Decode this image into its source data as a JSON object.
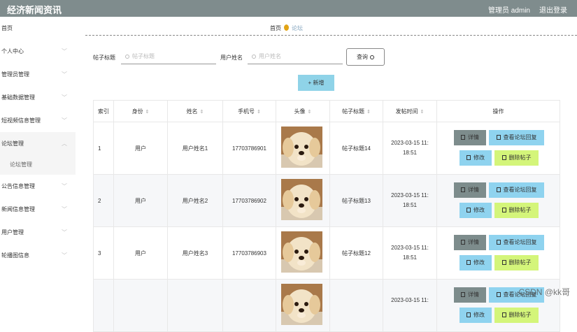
{
  "app": {
    "title": "经济新闻资讯",
    "admin_label": "管理员 admin",
    "logout_label": "退出登录"
  },
  "sidebar": {
    "items": [
      {
        "label": "首页",
        "has_chevron": false
      },
      {
        "label": "个人中心",
        "has_chevron": true
      },
      {
        "label": "管理员管理",
        "has_chevron": true
      },
      {
        "label": "基础数据管理",
        "has_chevron": true
      },
      {
        "label": "短视频信息管理",
        "has_chevron": true
      },
      {
        "label": "论坛管理",
        "has_chevron": true,
        "open": true
      },
      {
        "label": "公告信息管理",
        "has_chevron": true
      },
      {
        "label": "新闻信息管理",
        "has_chevron": true
      },
      {
        "label": "用户管理",
        "has_chevron": true
      },
      {
        "label": "轮播图信息",
        "has_chevron": true
      }
    ],
    "sub_item": "论坛管理"
  },
  "breadcrumb": {
    "home": "首页",
    "current": "论坛"
  },
  "search": {
    "title_label": "帖子标题",
    "title_placeholder": "帖子标题",
    "user_label": "用户姓名",
    "user_placeholder": "用户姓名",
    "search_button": "查询",
    "add_button": "+ 新增"
  },
  "table": {
    "headers": [
      "索引",
      "身份",
      "姓名",
      "手机号",
      "头像",
      "帖子标题",
      "发帖时间",
      "操作"
    ],
    "rows": [
      {
        "index": "1",
        "role": "用户",
        "name": "用户姓名1",
        "phone": "17703786901",
        "post_title": "帖子标题14",
        "time_line1": "2023-03-15 11:",
        "time_line2": "18:51"
      },
      {
        "index": "2",
        "role": "用户",
        "name": "用户姓名2",
        "phone": "17703786902",
        "post_title": "帖子标题13",
        "time_line1": "2023-03-15 11:",
        "time_line2": "18:51"
      },
      {
        "index": "3",
        "role": "用户",
        "name": "用户姓名3",
        "phone": "17703786903",
        "post_title": "帖子标题12",
        "time_line1": "2023-03-15 11:",
        "time_line2": "18:51"
      },
      {
        "index": "",
        "role": "",
        "name": "",
        "phone": "",
        "post_title": "",
        "time_line1": "2023-03-15 11:",
        "time_line2": ""
      }
    ],
    "actions": {
      "detail": "详情",
      "view_replies": "查看论坛回复",
      "edit": "修改",
      "delete": "删除帖子"
    }
  },
  "watermark": "CSDN @kk哥",
  "colors": {
    "topbar": "#7f8c8d",
    "accent_blue": "#8fd3ef",
    "accent_green": "#d4f57a",
    "detail_gray": "#7d8c8c"
  }
}
